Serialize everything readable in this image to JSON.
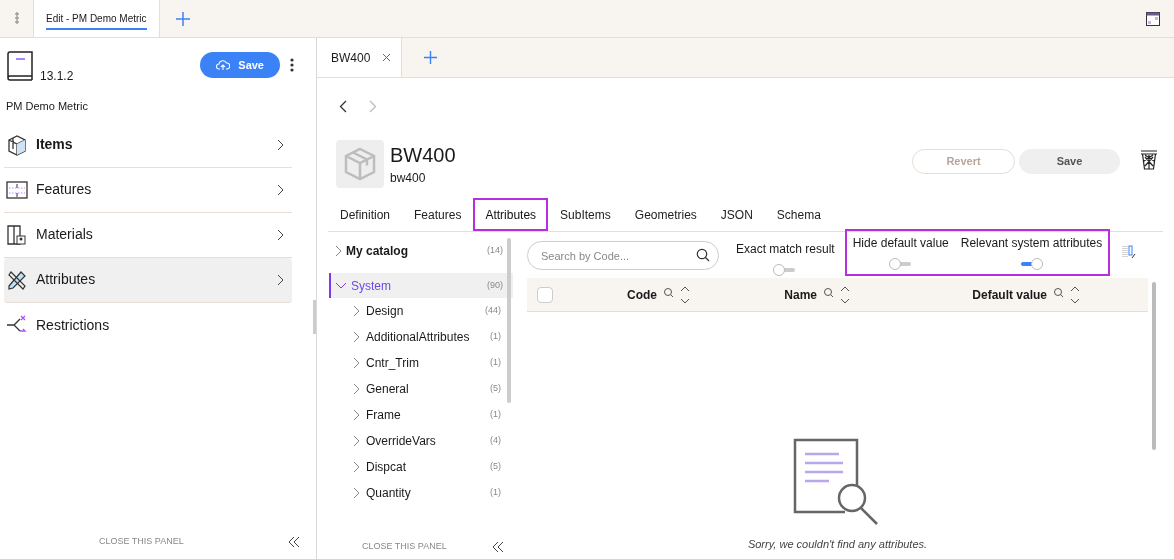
{
  "app_tabs": [
    {
      "label": "Edit - PM Demo Metric",
      "selected": true
    }
  ],
  "left_panel": {
    "version": "13.1.2",
    "catalog_name": "PM Demo Metric",
    "save_label": "Save",
    "nav": [
      {
        "label": "Items",
        "kind": "items",
        "selected": false,
        "bold": true
      },
      {
        "label": "Features",
        "kind": "features",
        "selected": false,
        "bold": false
      },
      {
        "label": "Materials",
        "kind": "materials",
        "selected": false,
        "bold": false
      },
      {
        "label": "Attributes",
        "kind": "attributes",
        "selected": true,
        "bold": false
      },
      {
        "label": "Restrictions",
        "kind": "restrictions",
        "selected": false,
        "bold": false
      }
    ],
    "close_label": "CLOSE THIS PANEL"
  },
  "doc_tabs": [
    {
      "label": "BW400",
      "selected": true
    }
  ],
  "item": {
    "title": "BW400",
    "code": "bw400",
    "revert_label": "Revert",
    "save_label": "Save"
  },
  "item_tabs": [
    {
      "label": "Definition",
      "selected": false,
      "highlighted": false
    },
    {
      "label": "Features",
      "selected": false,
      "highlighted": false
    },
    {
      "label": "Attributes",
      "selected": true,
      "highlighted": true
    },
    {
      "label": "SubItems",
      "selected": false,
      "highlighted": false
    },
    {
      "label": "Geometries",
      "selected": false,
      "highlighted": false
    },
    {
      "label": "JSON",
      "selected": false,
      "highlighted": false
    },
    {
      "label": "Schema",
      "selected": false,
      "highlighted": false
    }
  ],
  "tree": [
    {
      "label": "My catalog",
      "count": "(14)",
      "expanded": false,
      "selected": false
    },
    {
      "label": "System",
      "count": "(90)",
      "expanded": true,
      "selected": true,
      "children": [
        {
          "label": "Design",
          "count": "(44)"
        },
        {
          "label": "AdditionalAttributes",
          "count": "(1)"
        },
        {
          "label": "Cntr_Trim",
          "count": "(1)"
        },
        {
          "label": "General",
          "count": "(5)"
        },
        {
          "label": "Frame",
          "count": "(1)"
        },
        {
          "label": "OverrideVars",
          "count": "(4)"
        },
        {
          "label": "Dispcat",
          "count": "(5)"
        },
        {
          "label": "Quantity",
          "count": "(1)"
        }
      ]
    }
  ],
  "tree_close_label": "CLOSE THIS PANEL",
  "search": {
    "placeholder": "Search by Code..."
  },
  "toggles": [
    {
      "label": "Exact match result",
      "on": false,
      "highlighted": false
    },
    {
      "label": "Hide default value",
      "on": false,
      "highlighted": true
    },
    {
      "label": "Relevant system attributes",
      "on": true,
      "highlighted": true
    }
  ],
  "table": {
    "select_all": {
      "checked": false
    },
    "columns": [
      "Code",
      "Name",
      "Default value"
    ],
    "empty_message": "Sorry, we couldn't find any attributes."
  }
}
